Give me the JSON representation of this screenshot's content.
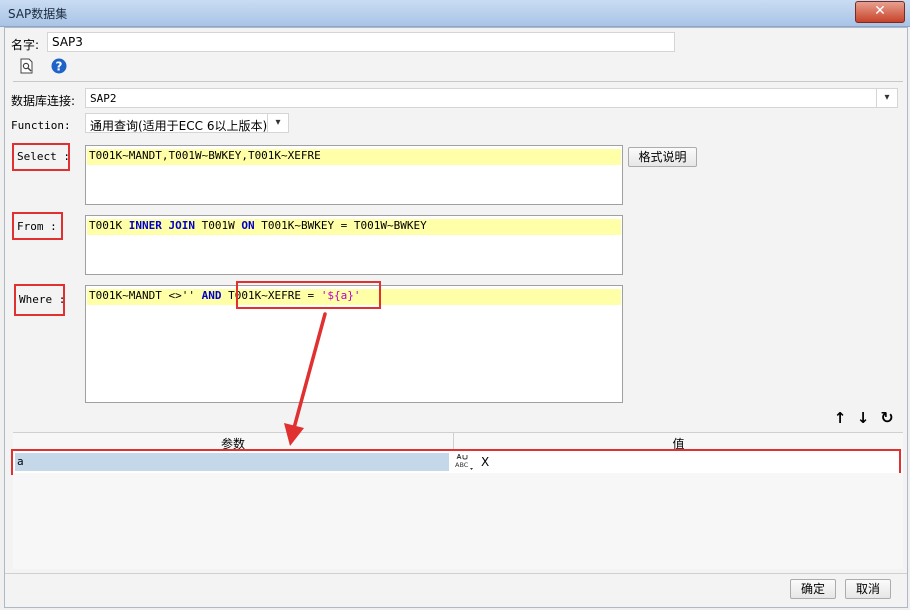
{
  "window": {
    "title": "SAP数据集",
    "close_glyph": "✕"
  },
  "name": {
    "label": "名字:",
    "value": "SAP3"
  },
  "toolbar": {
    "preview_icon": "preview-icon",
    "help_icon": "help-icon"
  },
  "db": {
    "label": "数据库连接:",
    "value": "SAP2"
  },
  "function": {
    "label": "Function:",
    "value": "通用查询(适用于ECC 6以上版本)"
  },
  "select": {
    "label": "Select :",
    "code": "T001K~MANDT,T001W~BWKEY,T001K~XEFRE"
  },
  "format_button": "格式说明",
  "from": {
    "label": "From :",
    "tokens": [
      "T001K ",
      "INNER JOIN",
      " T001W ",
      "ON",
      " T001K~BWKEY = T001W~BWKEY"
    ]
  },
  "where": {
    "label": "Where :",
    "tokens": [
      "T001K~MANDT <>'' ",
      "AND",
      " T001K~XEFRE = ",
      "'${a}'"
    ]
  },
  "side_tools": {
    "up": "↑",
    "down": "↓",
    "refresh": "↻"
  },
  "params": {
    "col_param": "参数",
    "col_value": "值",
    "rows": [
      {
        "name": "a",
        "type_icon": "ABC",
        "value": "X"
      }
    ]
  },
  "footer": {
    "ok": "确定",
    "cancel": "取消"
  },
  "colors": {
    "highlight": "#ffffa8",
    "keyword": "#0000c8",
    "string": "#c000c0",
    "annotation": "#e03030"
  }
}
